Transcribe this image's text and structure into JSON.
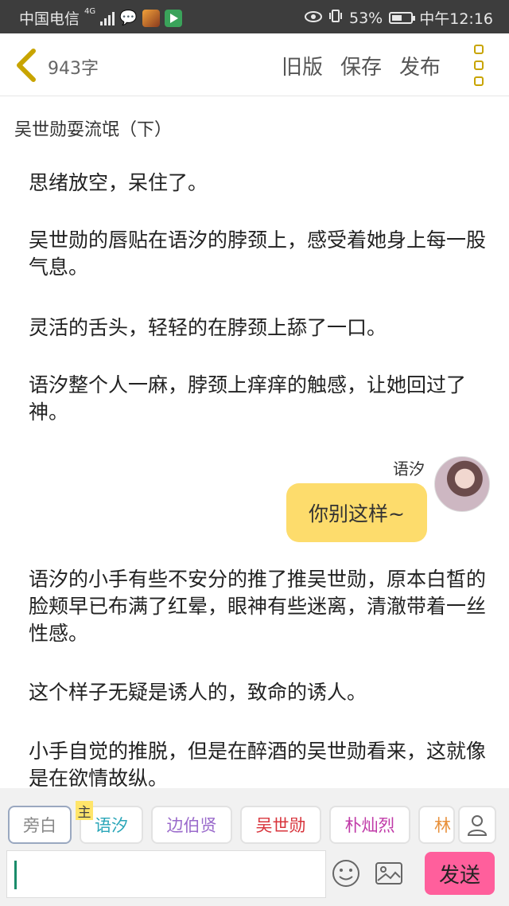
{
  "status_bar": {
    "carrier": "中国电信",
    "network": "4G",
    "battery_level": 0.53,
    "battery": "53%",
    "time": "中午12:16"
  },
  "header": {
    "word_count": "943字",
    "actions": [
      "旧版",
      "保存",
      "发布"
    ]
  },
  "chapter_title": "吴世勋耍流氓（下）",
  "content": {
    "paragraphs_top": [
      "思绪放空，呆住了。",
      "吴世勋的唇贴在语汐的脖颈上，感受着她身上每一股气息。",
      "灵活的舌头，轻轻的在脖颈上舔了一口。",
      "语汐整个人一麻，脖颈上痒痒的触感，让她回过了神。"
    ],
    "dialogue": {
      "speaker": "语汐",
      "text": "你别这样~"
    },
    "paragraphs_bottom": [
      "语汐的小手有些不安分的推了推吴世勋，原本白皙的脸颊早已布满了红晕，眼神有些迷离，清澈带着一丝性感。",
      "这个样子无疑是诱人的，致命的诱人。",
      "小手自觉的推脱，但是在醉酒的吴世勋看来，这就像是在欲情故纵。"
    ]
  },
  "character_bar": {
    "main_badge": "主",
    "chips": [
      {
        "label": "旁白",
        "color": "#888888"
      },
      {
        "label": "语汐",
        "color": "#2aa6b8"
      },
      {
        "label": "边伯贤",
        "color": "#9a6acb"
      },
      {
        "label": "吴世勋",
        "color": "#d8343c"
      },
      {
        "label": "朴灿烈",
        "color": "#c03aa8"
      },
      {
        "label": "林",
        "color": "#e8903a"
      }
    ]
  },
  "composer": {
    "input_value": "",
    "send_label": "发送"
  },
  "colors": {
    "accent": "#fddc6c",
    "send": "#ff5f9c",
    "menu": "#c8a400"
  }
}
